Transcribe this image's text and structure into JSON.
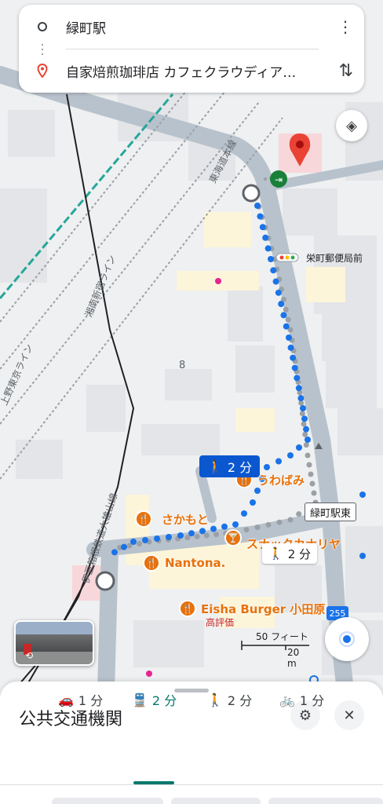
{
  "search": {
    "origin": "緑町駅",
    "destination": "自家焙煎珈琲店 カフェクラウディア…",
    "menu_icon": "more-vert-icon",
    "swap_icon": "swap-vertical-icon"
  },
  "map": {
    "rail_labels": [
      "東海道本線",
      "湘南新宿ライン",
      "上野東京ライン",
      "伊豆箱根鉄道大雄山線"
    ],
    "block_number": "8",
    "bus_stop": "栄町郵便局前",
    "station": "緑町駅東",
    "route_number": "255",
    "walk_time_blue": "2 分",
    "walk_time_white": "2 分",
    "scale_feet": "50 フィート",
    "scale_meters": "20 m",
    "pois": [
      {
        "name": "うわばみ",
        "icon": "restaurant-icon"
      },
      {
        "name": "さかもと",
        "icon": "restaurant-icon"
      },
      {
        "name": "スナックカナリヤ",
        "icon": "bar-icon"
      },
      {
        "name": "Nantona.",
        "icon": "restaurant-icon"
      },
      {
        "name": "Eisha Burger 小田原",
        "sub": "高評価",
        "icon": "restaurant-icon"
      }
    ]
  },
  "sheet": {
    "title": "公共交通機関",
    "modes": [
      {
        "icon": "car-icon",
        "label": "1 分"
      },
      {
        "icon": "transit-icon",
        "label": "2 分"
      },
      {
        "icon": "walk-icon",
        "label": "2 分"
      },
      {
        "icon": "bike-icon",
        "label": "1 分"
      }
    ],
    "active_mode": 1
  },
  "colors": {
    "accent": "#00796b",
    "route_blue": "#1a73e8",
    "poi_orange": "#e8710a",
    "pin_red": "#ea4335"
  }
}
